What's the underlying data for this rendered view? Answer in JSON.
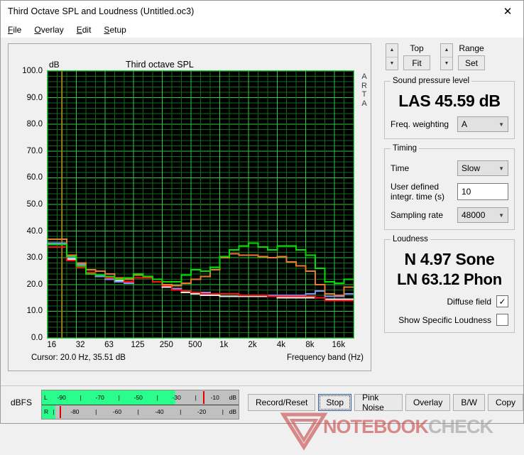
{
  "window": {
    "title": "Third Octave SPL and Loudness (Untitled.oc3)",
    "close_icon": "close-icon",
    "close_glyph": "✕"
  },
  "menu": {
    "items": [
      {
        "label": "File",
        "accel": "F"
      },
      {
        "label": "Overlay",
        "accel": "O"
      },
      {
        "label": "Edit",
        "accel": "E"
      },
      {
        "label": "Setup",
        "accel": "S"
      }
    ]
  },
  "chart": {
    "title": "Third octave SPL",
    "y_unit": "dB",
    "watermark_label": "ARTA",
    "cursor_text": "Cursor:   20.0 Hz, 35.51 dB",
    "x_axis_title": "Frequency band (Hz)",
    "plot_bg": "#000000",
    "grid_color": "#0e6b14",
    "grid_major_color": "#2ecc40"
  },
  "chart_data": {
    "type": "line",
    "title": "Third octave SPL",
    "xlabel": "Frequency band (Hz)",
    "ylabel": "dB",
    "ylim": [
      0.0,
      100.0
    ],
    "ytick_labels": [
      "0.0",
      "10.0",
      "20.0",
      "30.0",
      "40.0",
      "50.0",
      "60.0",
      "70.0",
      "80.0",
      "90.0",
      "100.0"
    ],
    "yticks": [
      0,
      10,
      20,
      30,
      40,
      50,
      60,
      70,
      80,
      90,
      100
    ],
    "xtick_labels": [
      "16",
      "32",
      "63",
      "125",
      "250",
      "500",
      "1k",
      "2k",
      "4k",
      "8k",
      "16k"
    ],
    "x_bands": [
      16,
      20,
      25,
      31.5,
      40,
      50,
      63,
      80,
      100,
      125,
      160,
      200,
      250,
      315,
      400,
      500,
      630,
      800,
      1000,
      1250,
      1600,
      2000,
      2500,
      3150,
      4000,
      5000,
      6300,
      8000,
      10000,
      12500,
      16000,
      20000
    ],
    "grid": true,
    "legend": "none",
    "step_style": "steps-post",
    "cursor_line_hz": 20,
    "cursor_line_color": "#9a7d1e",
    "series": [
      {
        "name": "overlay-green",
        "color": "#00e000",
        "values": [
          35.0,
          35.0,
          30.5,
          27.0,
          24.0,
          23.5,
          23.0,
          22.0,
          22.5,
          24.0,
          23.0,
          22.0,
          21.0,
          21.0,
          23.5,
          25.5,
          25.0,
          26.5,
          30.5,
          33.0,
          34.5,
          35.5,
          34.0,
          33.0,
          34.5,
          34.5,
          33.0,
          31.0,
          26.0,
          21.0,
          20.5,
          22.0
        ]
      },
      {
        "name": "overlay-orange",
        "color": "#e8792e",
        "values": [
          37.0,
          37.0,
          31.0,
          28.0,
          25.5,
          25.0,
          24.0,
          22.5,
          22.0,
          23.5,
          23.0,
          22.0,
          20.0,
          19.5,
          20.5,
          22.0,
          23.0,
          25.5,
          30.0,
          31.5,
          31.0,
          31.0,
          30.5,
          30.0,
          30.5,
          28.5,
          27.0,
          25.0,
          20.0,
          16.5,
          16.0,
          19.0
        ]
      },
      {
        "name": "overlay-red",
        "color": "#ff1010",
        "values": [
          34.0,
          34.0,
          29.0,
          26.5,
          24.5,
          23.5,
          22.5,
          22.0,
          21.0,
          22.5,
          22.5,
          21.0,
          19.5,
          18.0,
          17.5,
          17.0,
          16.5,
          16.5,
          16.5,
          16.5,
          16.0,
          16.0,
          16.0,
          15.5,
          15.5,
          15.5,
          15.5,
          15.5,
          15.0,
          14.0,
          14.0,
          14.0
        ]
      },
      {
        "name": "overlay-blue",
        "color": "#8a8aff",
        "values": [
          35.5,
          35.5,
          30.0,
          27.5,
          24.0,
          23.0,
          22.0,
          21.0,
          20.5,
          22.5,
          23.0,
          21.0,
          19.5,
          18.5,
          17.5,
          17.0,
          17.0,
          16.5,
          16.5,
          16.5,
          16.0,
          16.0,
          16.0,
          16.0,
          16.0,
          16.0,
          16.0,
          16.5,
          17.5,
          15.5,
          15.5,
          16.5
        ]
      },
      {
        "name": "overlay-white",
        "color": "#e8e8e8",
        "values": [
          35.5,
          35.5,
          29.5,
          27.0,
          24.0,
          23.0,
          22.0,
          21.5,
          21.0,
          22.5,
          22.5,
          21.0,
          19.0,
          18.0,
          17.0,
          16.5,
          16.0,
          16.0,
          15.5,
          15.5,
          15.5,
          15.5,
          15.5,
          15.5,
          15.0,
          15.0,
          15.0,
          15.0,
          15.0,
          14.5,
          14.5,
          14.5
        ]
      }
    ]
  },
  "controls": {
    "top": {
      "label": "Top",
      "button": "Fit",
      "up_icon": "caret-up-icon",
      "down_icon": "caret-down-icon"
    },
    "range": {
      "label": "Range",
      "button": "Set",
      "up_icon": "caret-up-icon",
      "down_icon": "caret-down-icon"
    }
  },
  "spl": {
    "legend": "Sound pressure level",
    "value": "LAS 45.59 dB",
    "weighting_label": "Freq. weighting",
    "weighting_value": "A"
  },
  "timing": {
    "legend": "Timing",
    "time_label": "Time",
    "time_value": "Slow",
    "integr_label": "User defined\nintegr. time (s)",
    "integr_label_line1": "User defined",
    "integr_label_line2": "integr. time (s)",
    "integr_value": "10",
    "sampling_label": "Sampling rate",
    "sampling_value": "48000"
  },
  "loudness": {
    "legend": "Loudness",
    "sone": "N 4.97 Sone",
    "phon": "LN 63.12 Phon",
    "diffuse_label": "Diffuse field",
    "diffuse_checked": true,
    "diffuse_glyph": "✓",
    "specific_label": "Show Specific Loudness",
    "specific_checked": false,
    "specific_glyph": ""
  },
  "meter": {
    "label": "dBFS",
    "unit": "dB",
    "left_channel": "L",
    "right_channel": "R",
    "left_ticks": [
      "-90",
      "|",
      "-70",
      "|",
      "-50",
      "|",
      "-30",
      "|",
      "-10"
    ],
    "right_ticks": [
      "|",
      "-80",
      "|",
      "-60",
      "|",
      "-40",
      "|",
      "-20",
      "|"
    ],
    "left_fill_pct": 68,
    "right_fill_pct": 7,
    "left_pin_pct": 82,
    "right_pin_pct": 9,
    "fill_color": "#2bfd8d",
    "pin_color": "#e00000"
  },
  "buttons": [
    {
      "label": "Record/Reset",
      "focused": false
    },
    {
      "label": "Stop",
      "focused": true
    },
    {
      "label": "Pink Noise",
      "focused": false
    },
    {
      "label": "Overlay",
      "focused": false
    },
    {
      "label": "B/W",
      "focused": false
    },
    {
      "label": "Copy",
      "focused": false
    }
  ],
  "watermark": {
    "part1": "NOTEBOOK",
    "part2": "CHECK"
  }
}
